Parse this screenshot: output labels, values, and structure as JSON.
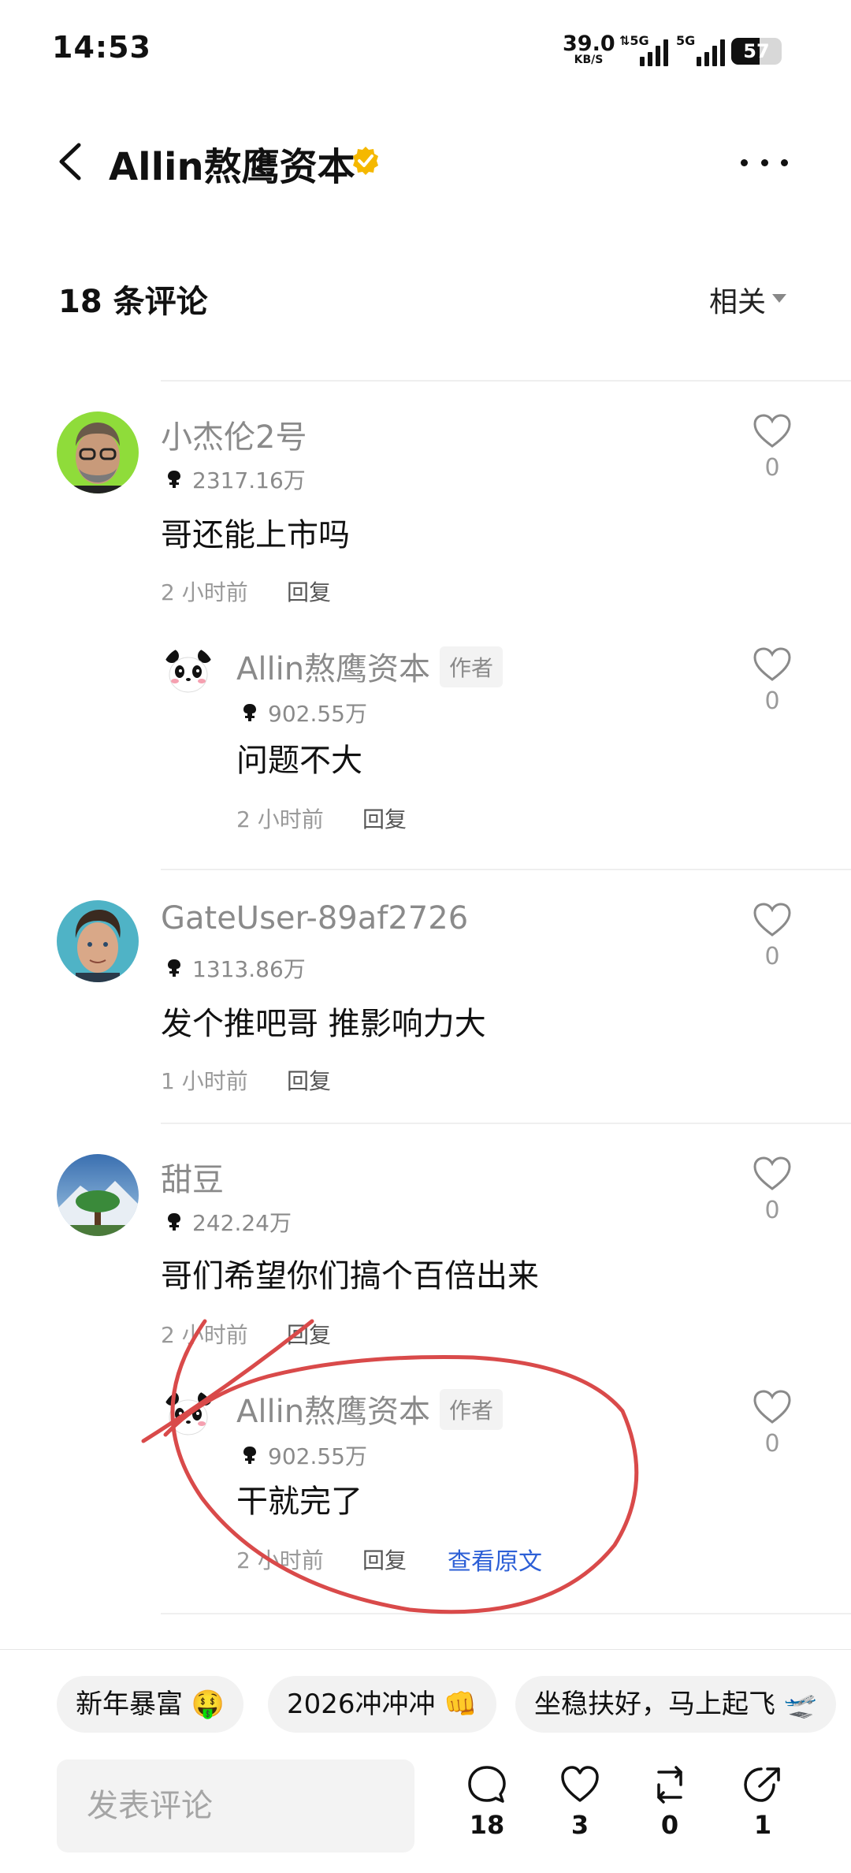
{
  "status_bar": {
    "time": "14:53",
    "net_speed": "39.0",
    "net_unit": "KB/S",
    "sig1_label": "⇅5G",
    "sig2_label": "5G",
    "battery": "57",
    "battery_level": 0.57
  },
  "header": {
    "title": "Allin熬鹰资本",
    "verified_icon": "verified-badge-icon",
    "more_icon": "more-dots-icon"
  },
  "comments_header": {
    "count_label": "18 条评论",
    "sort_label": "相关"
  },
  "comments": [
    {
      "name": "小杰伦2号",
      "rank": "2317.16万",
      "text": "哥还能上市吗",
      "time": "2 小时前",
      "reply": "回复",
      "likes": "0",
      "reply_item": {
        "name": "Allin熬鹰资本",
        "badge": "作者",
        "rank": "902.55万",
        "text": "问题不大",
        "time": "2 小时前",
        "reply": "回复",
        "likes": "0"
      }
    },
    {
      "name": "GateUser-89af2726",
      "rank": "1313.86万",
      "text": "发个推吧哥 推影响力大",
      "time": "1 小时前",
      "reply": "回复",
      "likes": "0"
    },
    {
      "name": "甜豆",
      "rank": "242.24万",
      "text": "哥们希望你们搞个百倍出来",
      "time": "2 小时前",
      "reply": "回复",
      "likes": "0",
      "reply_item": {
        "name": "Allin熬鹰资本",
        "badge": "作者",
        "rank": "902.55万",
        "text": "干就完了",
        "time": "2 小时前",
        "reply": "回复",
        "view_original": "查看原文",
        "likes": "0"
      }
    }
  ],
  "quick_replies": [
    "新年暴富 🤑",
    "2026冲冲冲 👊",
    "坐稳扶好，马上起飞 🛫"
  ],
  "bottom": {
    "input_placeholder": "发表评论",
    "comments_count": "18",
    "likes_count": "3",
    "reposts_count": "0",
    "shares_count": "1"
  },
  "colors": {
    "link": "#2c5fd6",
    "annotation": "#d94a4a",
    "verified": "#f5b800"
  }
}
